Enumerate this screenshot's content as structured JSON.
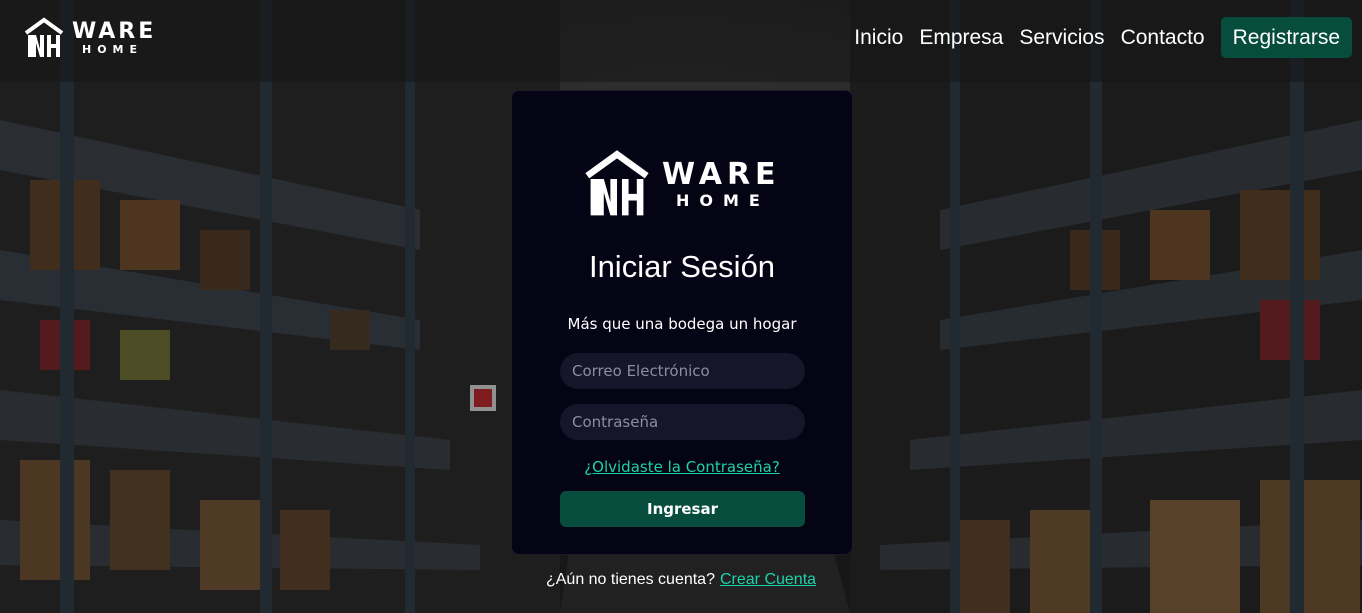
{
  "brand": {
    "word1": "WARE",
    "word2": "HOME",
    "mark_icon": "warehouse-wh-logo-icon"
  },
  "nav": {
    "links": [
      "Inicio",
      "Empresa",
      "Servicios",
      "Contacto"
    ],
    "register_label": "Registrarse"
  },
  "login": {
    "title": "Iniciar Sesión",
    "subtitle": "Más que una bodega un hogar",
    "email_placeholder": "Correo Electrónico",
    "password_placeholder": "Contraseña",
    "forgot_label": "¿Olvidaste la Contraseña?",
    "submit_label": "Ingresar"
  },
  "signup": {
    "prompt": "¿Aún no tienes cuenta?",
    "link_label": "Crear Cuenta"
  },
  "colors": {
    "accent": "#074d3d",
    "link": "#1fd1a8",
    "card_bg": "#050414",
    "input_bg": "#16152a"
  },
  "background": {
    "description_icon": "warehouse-aisle-photo"
  }
}
